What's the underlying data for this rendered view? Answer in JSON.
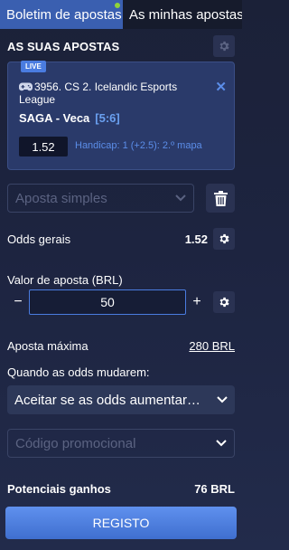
{
  "tabs": [
    {
      "label": "Boletim de apostas"
    },
    {
      "label": "As minhas apostas"
    }
  ],
  "header": {
    "title": "AS SUAS APOSTAS"
  },
  "bet": {
    "badge": "LIVE",
    "event": "3956. CS 2. Icelandic Esports League",
    "match": "SAGA - Veca",
    "score": "[5:6]",
    "odd": "1.52",
    "market": "Handicap: 1 (+2.5): 2.º mapa"
  },
  "bet_type": {
    "selected": "Aposta simples"
  },
  "odds": {
    "label": "Odds gerais",
    "value": "1.52"
  },
  "stake": {
    "label": "Valor de aposta (BRL)",
    "minus": "−",
    "plus": "+",
    "value": "50"
  },
  "max_bet": {
    "label": "Aposta máxima",
    "value": "280 BRL"
  },
  "odds_change": {
    "label": "Quando as odds mudarem:",
    "selected": "Aceitar se as odds aumentar…"
  },
  "promo": {
    "placeholder": "Código promocional"
  },
  "winnings": {
    "label": "Potenciais ganhos",
    "value": "76 BRL"
  },
  "register": {
    "label": "REGISTO"
  },
  "colors": {
    "accent": "#4a7ce0",
    "tab_active": "#3a5fb0",
    "live": "#4a7ce0",
    "dot": "#8fd33a"
  }
}
